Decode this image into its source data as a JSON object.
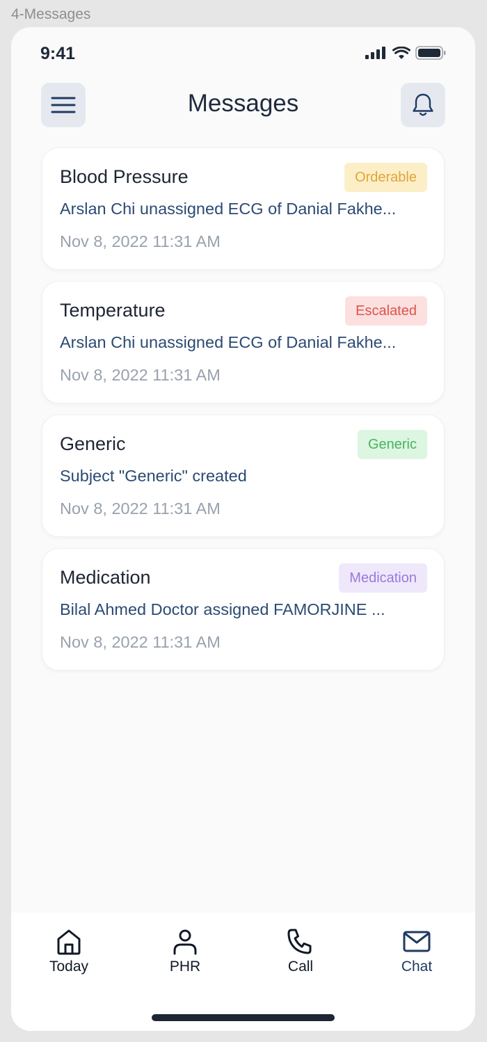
{
  "frame": {
    "label": "4-Messages"
  },
  "status_bar": {
    "time": "9:41"
  },
  "header": {
    "title": "Messages"
  },
  "messages": [
    {
      "title": "Blood Pressure",
      "badge": "Orderable",
      "badge_bg": "#fcefc7",
      "badge_color": "#e0a43c",
      "description": "Arslan Chi unassigned ECG of Danial Fakhe...",
      "timestamp": "Nov 8, 2022 11:31 AM"
    },
    {
      "title": "Temperature",
      "badge": "Escalated",
      "badge_bg": "#fbe0df",
      "badge_color": "#e0524a",
      "description": "Arslan Chi unassigned ECG of Danial Fakhe...",
      "timestamp": "Nov 8, 2022 11:31 AM"
    },
    {
      "title": "Generic",
      "badge": "Generic",
      "badge_bg": "#dcf6e1",
      "badge_color": "#47b35e",
      "description": "Subject \"Generic\" created",
      "timestamp": "Nov 8, 2022 11:31 AM"
    },
    {
      "title": "Medication",
      "badge": "Medication",
      "badge_bg": "#efe8fb",
      "badge_color": "#9a78dc",
      "description": "Bilal Ahmed Doctor assigned FAMORJINE ...",
      "timestamp": "Nov 8, 2022 11:31 AM"
    }
  ],
  "tabbar": {
    "items": [
      {
        "label": "Today",
        "icon": "home-icon"
      },
      {
        "label": "PHR",
        "icon": "person-icon"
      },
      {
        "label": "Call",
        "icon": "phone-icon"
      },
      {
        "label": "Chat",
        "icon": "mail-icon",
        "active": true
      }
    ]
  },
  "colors": {
    "text_primary": "#1e2533",
    "text_link": "#2b4a73",
    "text_muted": "#98a1ad",
    "active_tab": "#1f3a63"
  }
}
